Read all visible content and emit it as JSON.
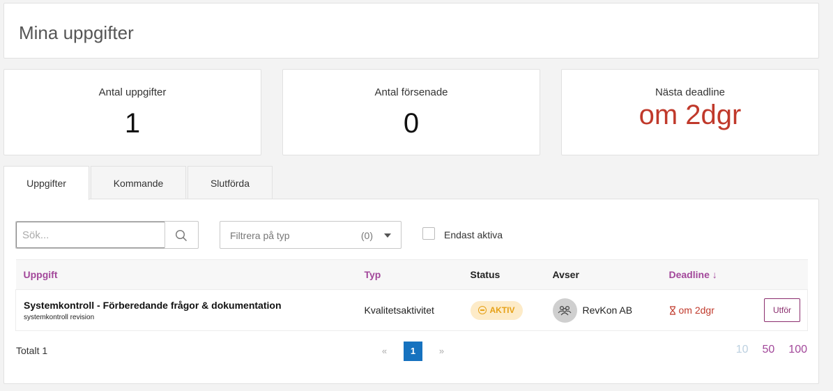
{
  "page": {
    "title": "Mina uppgifter"
  },
  "stats": [
    {
      "label": "Antal uppgifter",
      "value": "1"
    },
    {
      "label": "Antal försenade",
      "value": "0"
    },
    {
      "label": "Nästa deadline",
      "value": "om 2dgr",
      "color": "#c0392b"
    }
  ],
  "tabs": [
    {
      "label": "Uppgifter",
      "active": true
    },
    {
      "label": "Kommande",
      "active": false
    },
    {
      "label": "Slutförda",
      "active": false
    }
  ],
  "filters": {
    "search_placeholder": "Sök...",
    "search_icon": "search-icon",
    "type_placeholder": "Filtrera på typ",
    "type_count": "(0)",
    "only_active_label": "Endast aktiva",
    "only_active_checked": false
  },
  "table": {
    "columns": [
      "Uppgift",
      "Typ",
      "Status",
      "Avser",
      "Deadline ↓"
    ],
    "rows": [
      {
        "title": "Systemkontroll - Förberedande frågor & dokumentation",
        "subtitle": "systemkontroll revision",
        "type": "Kvalitetsaktivitet",
        "status": "AKTIV",
        "avser": "RevKon AB",
        "avser_icon": "group-icon",
        "deadline": "om 2dgr",
        "deadline_icon": "hourglass-icon",
        "action": "Utför"
      }
    ]
  },
  "footer": {
    "total": "Totalt 1",
    "prev": "«",
    "page": "1",
    "next": "»",
    "page_sizes": [
      "10",
      "50",
      "100"
    ]
  },
  "colors": {
    "accent": "#a2479a",
    "danger": "#c0392b",
    "pager_active": "#1672bf",
    "status_active_bg": "#fdebc8",
    "status_active_fg": "#e6a117"
  }
}
